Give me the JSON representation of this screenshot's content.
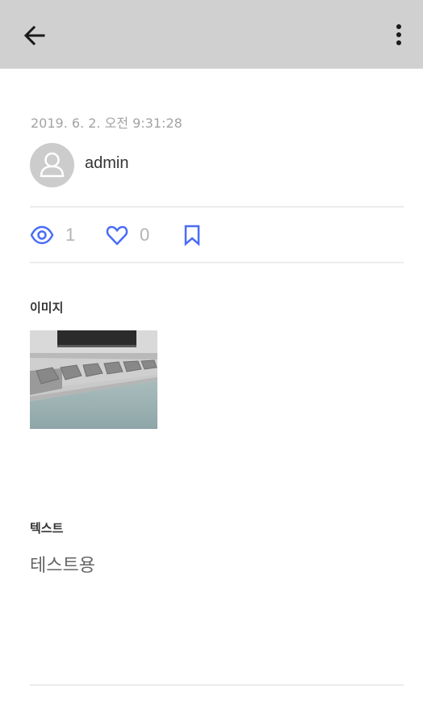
{
  "post": {
    "timestamp": "2019. 6. 2. 오전 9:31:28",
    "author": "admin",
    "views": "1",
    "likes": "0"
  },
  "sections": {
    "image_label": "이미지",
    "text_label": "텍스트",
    "text_value": "테스트용"
  },
  "colors": {
    "appbar": "#d0d0d0",
    "accent": "#4a6cf7",
    "muted_text": "#a3a3a3"
  },
  "icons": {
    "back": "arrow-left-icon",
    "more": "more-vertical-icon",
    "views": "eye-icon",
    "likes": "heart-icon",
    "bookmark": "bookmark-icon",
    "avatar": "person-icon"
  }
}
